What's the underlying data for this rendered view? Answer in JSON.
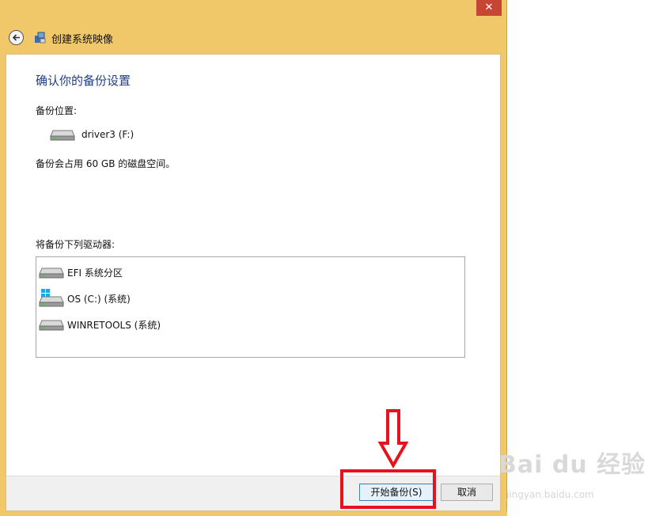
{
  "window": {
    "close_glyph": "✕",
    "title": "创建系统映像",
    "icons": {
      "back": "back-arrow-icon",
      "app": "system-image-icon"
    }
  },
  "main": {
    "heading": "确认你的备份设置",
    "location_label": "备份位置:",
    "location_drive": "driver3 (F:)",
    "space_note": "备份会占用 60 GB 的磁盘空间。",
    "drives_label": "将备份下列驱动器:",
    "drives": [
      {
        "name": "EFI 系统分区",
        "icon": "drive-icon"
      },
      {
        "name": "OS (C:) (系统)",
        "icon": "windows-drive-icon"
      },
      {
        "name": "WINRETOOLS (系统)",
        "icon": "drive-icon"
      }
    ]
  },
  "footer": {
    "start_label": "开始备份(S)",
    "cancel_label": "取消"
  },
  "watermark": {
    "brand": "Bai du 经验",
    "url": "jingyan.baidu.com"
  },
  "colors": {
    "frame": "#f0c86a",
    "heading": "#1e3d87",
    "annotation": "#e8121c",
    "close": "#c74633"
  }
}
